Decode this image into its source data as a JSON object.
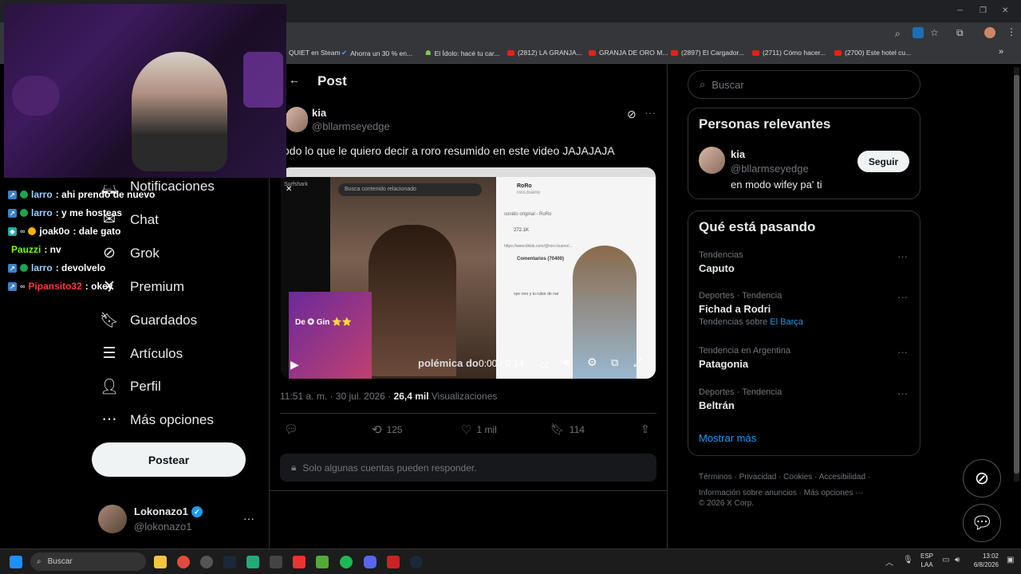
{
  "browser": {
    "bookmarks": [
      "QUIET en Steam",
      "Ahorra un 30 % en...",
      "El Ídolo: hacé tu car...",
      "(2812) LA GRANJA...",
      "GRANJA DE ORO M...",
      "(2897) El Cargador...",
      "(2711) Cómo hacer...",
      "(2700) Este hotel cu..."
    ],
    "more_bookmarks": "»"
  },
  "sidebar": {
    "items": [
      {
        "label": "Notificaciones",
        "icon": "bell-icon"
      },
      {
        "label": "Chat",
        "icon": "chat-icon"
      },
      {
        "label": "Grok",
        "icon": "grok-icon"
      },
      {
        "label": "Premium",
        "icon": "x-premium-icon"
      },
      {
        "label": "Guardados",
        "icon": "bookmark-icon"
      },
      {
        "label": "Artículos",
        "icon": "articles-icon"
      },
      {
        "label": "Perfil",
        "icon": "profile-icon"
      },
      {
        "label": "Más opciones",
        "icon": "more-icon"
      }
    ],
    "post_button": "Postear",
    "account": {
      "name": "Lokonazo1",
      "handle": "@lokonazo1",
      "more": "···"
    }
  },
  "chat_overlay": [
    {
      "user": "larro",
      "msg": ": ahi prendo de nuevo",
      "color": "#9ad0ff"
    },
    {
      "user": "larro",
      "msg": ": y me hosteas",
      "color": "#9ad0ff"
    },
    {
      "user": "joak0o",
      "msg": ": dale gato",
      "color": "#ffffff"
    },
    {
      "user": "Pauzzi",
      "msg": ": nv",
      "color": "#7cfc00"
    },
    {
      "user": "larro",
      "msg": ": devolvelo",
      "color": "#9ad0ff"
    },
    {
      "user": "Pipansito32",
      "msg": ": okey",
      "color": "#ff3b3b"
    }
  ],
  "post": {
    "header": "Post",
    "author_name": "kia",
    "author_handle": "@bllarmseyedge",
    "text": "odo lo que le quiero decir a roro resumido en este video JAJAJAJA",
    "video": {
      "time": "0:00 / 0:14",
      "caption": "polémica do",
      "banner": "De ✪ Gin ⭐⭐",
      "search_placeholder": "Busca contenido relacionado",
      "brand": "Surfshark",
      "side_profile_name": "RoRo",
      "side_profile_handle": "roro.bueno",
      "side_comments": "Comentarios (70400)",
      "side_link": "https://www.tiktok.com/@roro.bueno/...",
      "side_music": "sonido original - RoRo",
      "side_likes": "272.1K",
      "side_reply": "oye roro y tu rubor de nar"
    },
    "timestamp": "11:51 a. m. · 30 jul. 2026 · ",
    "views_count": "26,4 mil",
    "views_label": " Visualizaciones",
    "retweets": "125",
    "likes": "1 mil",
    "bookmarks": "114",
    "reply_restriction": "Solo algunas cuentas pueden responder."
  },
  "right": {
    "search_placeholder": "Buscar",
    "relevant_title": "Personas relevantes",
    "relevant": {
      "name": "kia",
      "handle": "@bllarmseyedge",
      "bio": "en modo wifey pa' ti",
      "follow": "Seguir"
    },
    "trends_title": "Qué está pasando",
    "trends": [
      {
        "category": "Tendencias",
        "name": "Caputo",
        "extra": ""
      },
      {
        "category": "Deportes · Tendencia",
        "name": "Fichad a Rodri",
        "extra": "Tendencias sobre ",
        "extra_link": "El Barça"
      },
      {
        "category": "Tendencia en Argentina",
        "name": "Patagonia",
        "extra": ""
      },
      {
        "category": "Deportes · Tendencia",
        "name": "Beltrán",
        "extra": ""
      }
    ],
    "show_more": "Mostrar más",
    "footer": [
      "Términos",
      "Privacidad",
      "Cookies",
      "Accesibilidad",
      "Información sobre anuncios",
      "Más opciones ···",
      "© 2026 X Corp."
    ]
  },
  "taskbar": {
    "search": "Buscar",
    "lang": "ESP",
    "lang2": "LAA",
    "time": "13:02",
    "date": "6/8/2026"
  },
  "colors": {
    "accent": "#1d9bf0",
    "background": "#000000",
    "border": "#2f3336",
    "muted": "#71767b"
  }
}
